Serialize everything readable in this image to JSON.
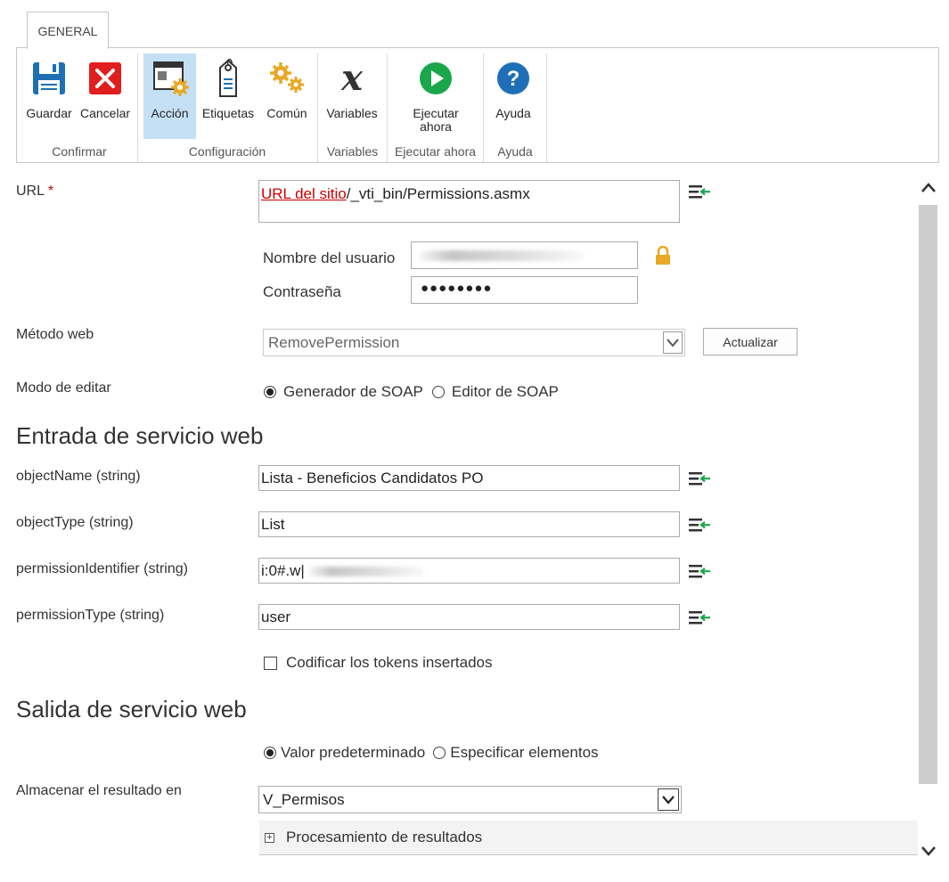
{
  "ribbon": {
    "tab_label": "GENERAL",
    "buttons": [
      {
        "label": "Guardar",
        "icon": "save-icon"
      },
      {
        "label": "Cancelar",
        "icon": "cancel-icon"
      },
      {
        "label": "Acción",
        "icon": "action-icon",
        "selected": true
      },
      {
        "label": "Etiquetas",
        "icon": "tag-icon"
      },
      {
        "label": "Común",
        "icon": "gears-icon"
      },
      {
        "label": "Variables",
        "icon": "variables-icon"
      },
      {
        "label": "Ejecutar ahora",
        "icon": "play-icon"
      },
      {
        "label": "Ayuda",
        "icon": "help-icon"
      }
    ],
    "groups": {
      "confirm": "Confirmar",
      "config": "Configuración",
      "variables": "Variables",
      "run": "Ejecutar ahora",
      "help": "Ayuda"
    },
    "colors": {
      "save": "#1e6fb3",
      "cancel": "#e01e1e",
      "run": "#1aa64a",
      "help": "#1f6fb8",
      "selected": "#c5e0f5"
    }
  },
  "form": {
    "url_label": "URL",
    "url_required": "*",
    "url_link": "URL del sitio",
    "url_rest": "/_vti_bin/Permissions.asmx",
    "username_label": "Nombre del usuario",
    "password_label": "Contraseña",
    "password_value": "●●●●●●●●",
    "method_label": "Método web",
    "method_value": "RemovePermission",
    "refresh_button": "Actualizar",
    "edit_mode_label": "Modo de editar",
    "edit_mode_options": [
      "Generador de SOAP",
      "Editor de SOAP"
    ],
    "input_heading": "Entrada de servicio web",
    "params": [
      {
        "label": "objectName (string)",
        "value": "Lista - Beneficios Candidatos PO"
      },
      {
        "label": "objectType (string)",
        "value": "List"
      },
      {
        "label": "permissionIdentifier (string)",
        "value": "i:0#.w|"
      },
      {
        "label": "permissionType (string)",
        "value": "user"
      }
    ],
    "encode_tokens_label": "Codificar los tokens insertados",
    "output_heading": "Salida de servicio web",
    "output_options": [
      "Valor predeterminado",
      "Especificar elementos"
    ],
    "store_label": "Almacenar el resultado en",
    "store_value": "V_Permisos",
    "processing_label": "Procesamiento de resultados",
    "processing_expander": "+"
  }
}
